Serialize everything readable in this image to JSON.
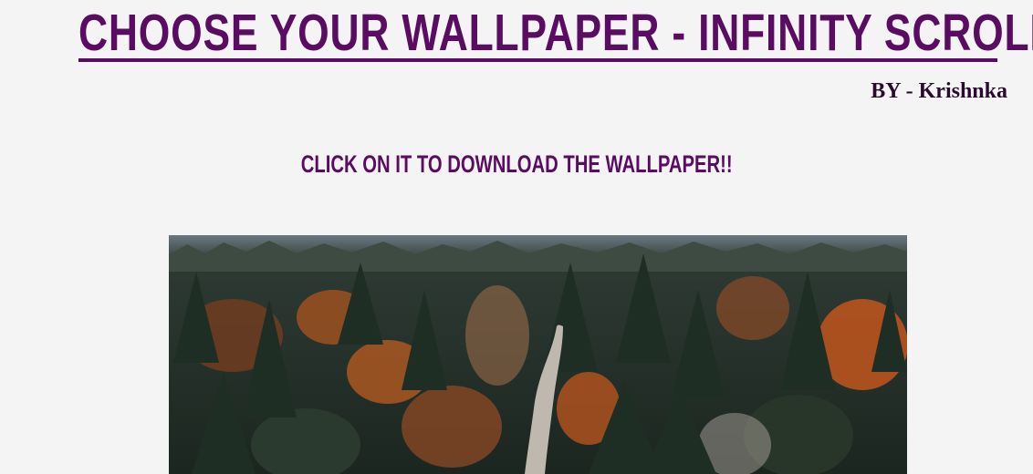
{
  "header": {
    "title": "CHOOSE YOUR WALLPAPER - INFINITY SCROLL",
    "byline": "BY - Krishnka"
  },
  "main": {
    "instruction": "CLICK ON IT TO DOWNLOAD THE WALLPAPER!!"
  },
  "colors": {
    "accent": "#5a0c63",
    "background": "#f4f4f4"
  },
  "gallery": {
    "images": [
      {
        "subject": "aerial autumn forest with dirt road"
      }
    ]
  }
}
